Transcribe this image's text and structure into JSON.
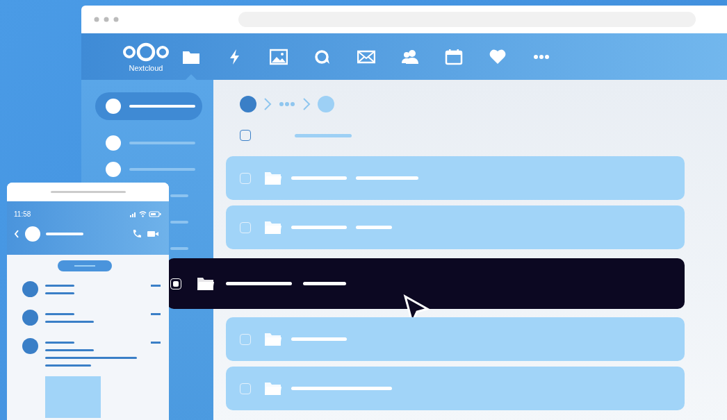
{
  "app_name": "Nextcloud",
  "nav_items": [
    {
      "kind": "folder",
      "selected": true
    },
    {
      "kind": "bolt",
      "selected": false
    },
    {
      "kind": "image",
      "selected": false
    },
    {
      "kind": "chat",
      "selected": false
    },
    {
      "kind": "mail",
      "selected": false
    },
    {
      "kind": "people",
      "selected": false
    },
    {
      "kind": "calendar",
      "selected": false
    },
    {
      "kind": "heart",
      "selected": false
    },
    {
      "kind": "more",
      "selected": false
    }
  ],
  "sidebar_items": [
    {
      "selected": true
    },
    {
      "selected": false
    },
    {
      "selected": false
    },
    {
      "selected": false
    },
    {
      "selected": false
    },
    {
      "selected": false
    }
  ],
  "select_all": {
    "checked": false
  },
  "rows": [
    {
      "selected": false,
      "checked": false
    },
    {
      "selected": false,
      "checked": false
    },
    {
      "selected": true,
      "checked": true
    },
    {
      "selected": false,
      "checked": false
    },
    {
      "selected": false,
      "checked": false
    }
  ],
  "phone": {
    "time": "11:58"
  }
}
